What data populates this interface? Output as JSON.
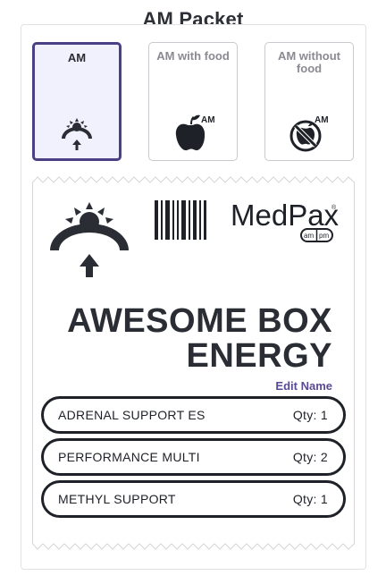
{
  "page": {
    "title": "AM Packet"
  },
  "options": [
    {
      "label": "AM",
      "icon": "sunrise-icon",
      "selected": true
    },
    {
      "label": "AM with food",
      "icon": "apple-icon",
      "badge": "AM",
      "selected": false
    },
    {
      "label": "AM without food",
      "icon": "no-food-icon",
      "badge": "AM",
      "selected": false
    }
  ],
  "packet": {
    "brand": "MedPax",
    "brand_badge_left": "am",
    "brand_badge_right": "pm",
    "name_line1": "AWESOME BOX",
    "name_line2": "ENERGY",
    "edit_label": "Edit Name",
    "supplements": [
      {
        "name": "ADRENAL SUPPORT ES",
        "qty": "Qty: 1"
      },
      {
        "name": "PERFORMANCE MULTI",
        "qty": "Qty: 2"
      },
      {
        "name": "METHYL SUPPORT",
        "qty": "Qty: 1"
      }
    ]
  },
  "colors": {
    "accent": "#4b3f86",
    "selected_bg": "#f1f0fd",
    "text": "#2b2d35",
    "link": "#5a4a95"
  }
}
